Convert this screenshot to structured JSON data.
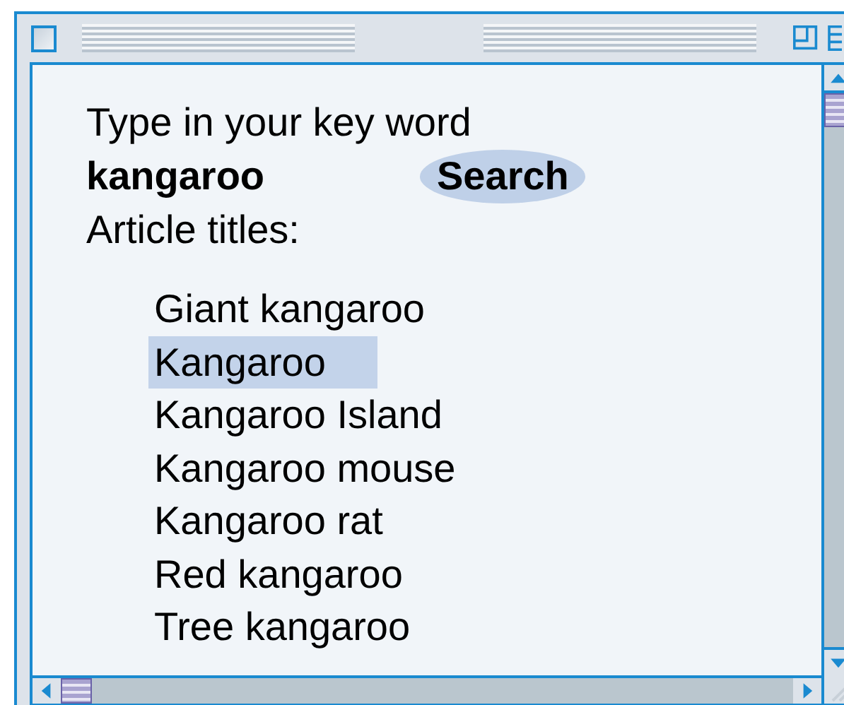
{
  "query": {
    "prompt": "Type in your key word",
    "value": "kangaroo",
    "button": "Search"
  },
  "results": {
    "label": "Article titles:",
    "items": [
      {
        "title": "Giant kangaroo",
        "selected": false
      },
      {
        "title": "Kangaroo",
        "selected": true
      },
      {
        "title": "Kangaroo Island",
        "selected": false
      },
      {
        "title": "Kangaroo mouse",
        "selected": false
      },
      {
        "title": "Kangaroo rat",
        "selected": false
      },
      {
        "title": "Red kangaroo",
        "selected": false
      },
      {
        "title": "Tree kangaroo",
        "selected": false
      }
    ]
  }
}
